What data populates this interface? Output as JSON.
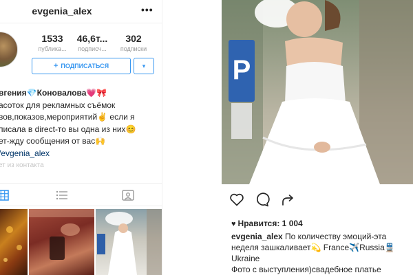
{
  "profile": {
    "username": "evgenia_alex",
    "more_icon": "•••",
    "stats": [
      {
        "value": "1533",
        "label": "публика..."
      },
      {
        "value": "46,6т...",
        "label": "подписч..."
      },
      {
        "value": "302",
        "label": "подписки"
      }
    ],
    "follow_label": "ПОДПИСАТЬСЯ",
    "follow_plus": "+",
    "dropdown_icon": "▾",
    "bio": {
      "name": "вгения💎Коновалова💗🎀",
      "lines": [
        "асоток для рекламных съёмок",
        "вов,показов,мероприятий✌️ если я",
        "писала в direct-то вы одна из них😊",
        "ет-жду сообщения от вас🙌"
      ],
      "link": "/evgenia_alex",
      "faded": "ет из контакта"
    },
    "tabs": [
      "grid-icon",
      "list-icon",
      "tagged-icon"
    ],
    "accent_color": "#3897f0"
  },
  "post": {
    "likes_heart": "♥",
    "likes_text": "Нравится: 1 004",
    "caption_author": "evgenia_alex",
    "caption_lines": [
      " По количеству эмоций-эта",
      "неделя зашкаливает💫 France✈️Russia🚆",
      "Ukraine",
      "Фото с выступления)свадебное платье"
    ],
    "action_icons": [
      "heart-outline-icon",
      "comment-bubble-icon",
      "share-arrow-icon"
    ]
  }
}
